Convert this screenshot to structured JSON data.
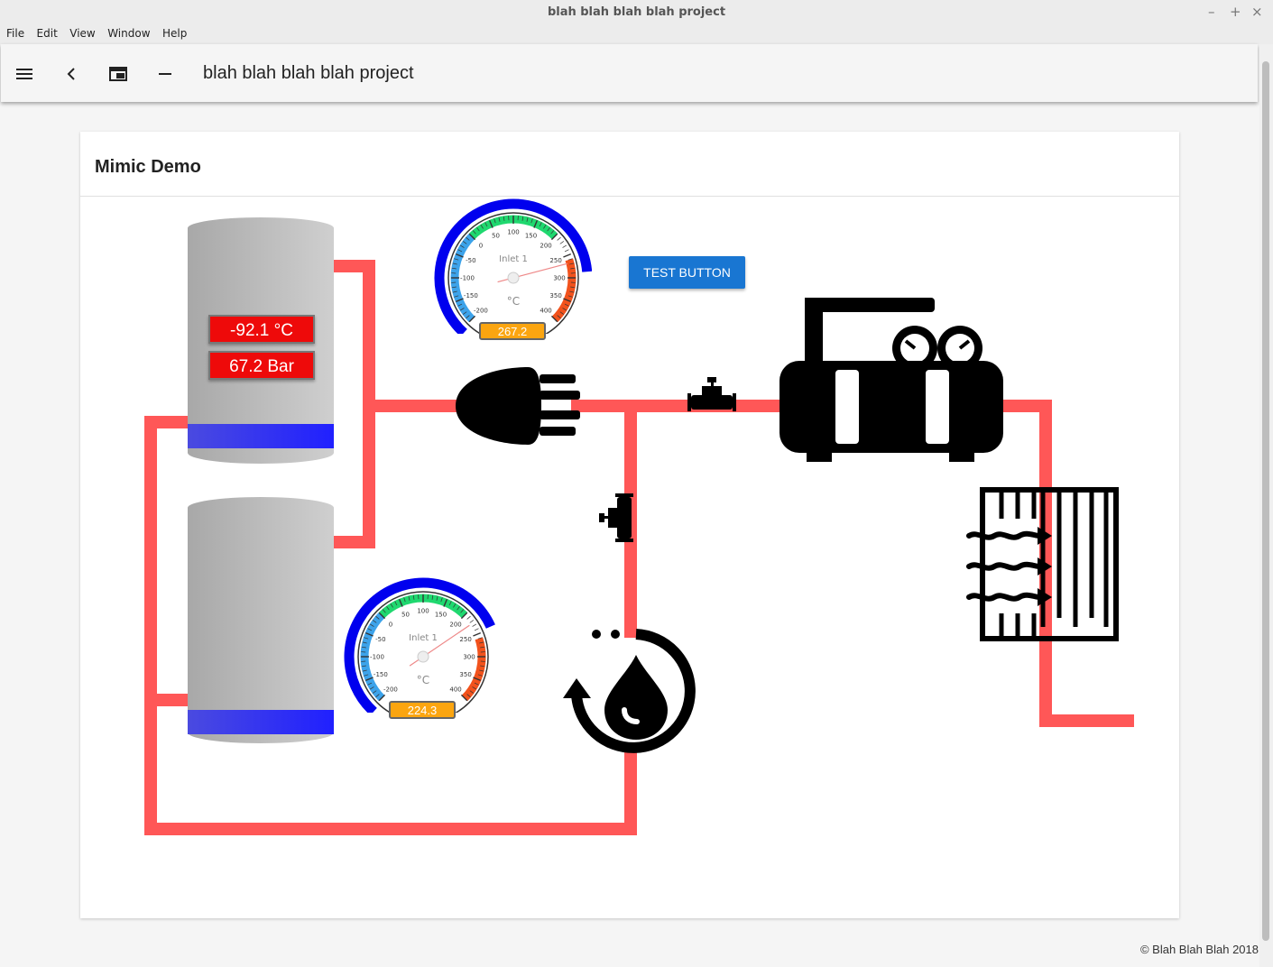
{
  "window": {
    "title": "blah blah blah blah project",
    "controls": [
      "–",
      "+",
      "×"
    ]
  },
  "menu": [
    "File",
    "Edit",
    "View",
    "Window",
    "Help"
  ],
  "toolbar": {
    "title": "blah blah blah blah project"
  },
  "card": {
    "title": "Mimic Demo"
  },
  "button": {
    "label": "TEST BUTTON"
  },
  "tank1": {
    "temperature": "-92.1 °C",
    "pressure": "67.2 Bar"
  },
  "gauge1": {
    "label": "Inlet 1",
    "unit": "°C",
    "value": "267.2",
    "reading": 267.2,
    "ticks": [
      "-200",
      "-150",
      "-100",
      "-50",
      "0",
      "50",
      "100",
      "150",
      "200",
      "250",
      "300",
      "350",
      "400"
    ]
  },
  "gauge2": {
    "label": "Inlet 1",
    "unit": "°C",
    "value": "224.3",
    "reading": 224.3,
    "ticks": [
      "-200",
      "-150",
      "-100",
      "-50",
      "0",
      "50",
      "100",
      "150",
      "200",
      "250",
      "300",
      "350",
      "400"
    ]
  },
  "colors": {
    "pipe": "#ff5757",
    "button": "#1976d2",
    "readout": "#ee0a0a",
    "gauge_value": "#fba510",
    "band": "#2020ff"
  },
  "footer": "© Blah Blah Blah 2018"
}
